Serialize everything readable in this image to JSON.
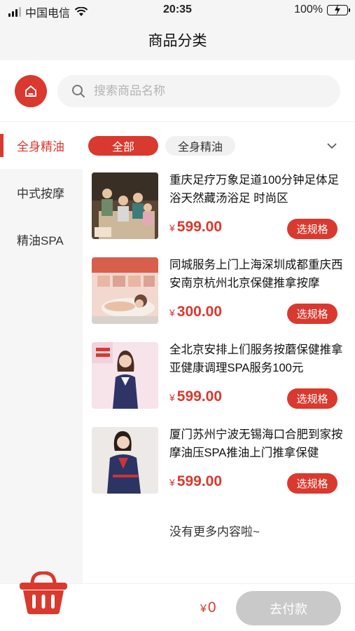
{
  "status_bar": {
    "carrier": "中国电信",
    "time": "20:35",
    "battery": "100%"
  },
  "header": {
    "title": "商品分类"
  },
  "search": {
    "placeholder": "搜索商品名称"
  },
  "sidebar": {
    "items": [
      {
        "label": "全身精油",
        "active": true
      },
      {
        "label": "中式按摩",
        "active": false
      },
      {
        "label": "精油SPA",
        "active": false
      }
    ]
  },
  "filters": {
    "chips": [
      {
        "label": "全部",
        "active": true
      },
      {
        "label": "全身精油",
        "active": false
      }
    ]
  },
  "products": [
    {
      "title": "重庆足疗万象足道100分钟足体足浴天然藏汤浴足 时尚区",
      "currency": "¥",
      "price": "599.00",
      "button": "选规格"
    },
    {
      "title": "同城服务上门上海深圳成都重庆西安南京杭州北京保健推拿按摩",
      "currency": "¥",
      "price": "300.00",
      "button": "选规格"
    },
    {
      "title": "全北京安排上们服务按蘑保健推拿亚健康调理SPA服务100元",
      "currency": "¥",
      "price": "599.00",
      "button": "选规格"
    },
    {
      "title": "厦门苏州宁波无锡海口合肥到家按摩油压SPA推油上门推拿保健",
      "currency": "¥",
      "price": "599.00",
      "button": "选规格"
    }
  ],
  "list_end": "没有更多内容啦~",
  "bottom": {
    "currency": "¥",
    "total": "0",
    "pay_label": "去付款"
  },
  "colors": {
    "accent": "#d9392e",
    "disabled": "#c9c9c9"
  },
  "icons": [
    "home-icon",
    "search-icon",
    "chevron-down-icon",
    "cart-icon",
    "wifi-icon",
    "battery-icon"
  ]
}
